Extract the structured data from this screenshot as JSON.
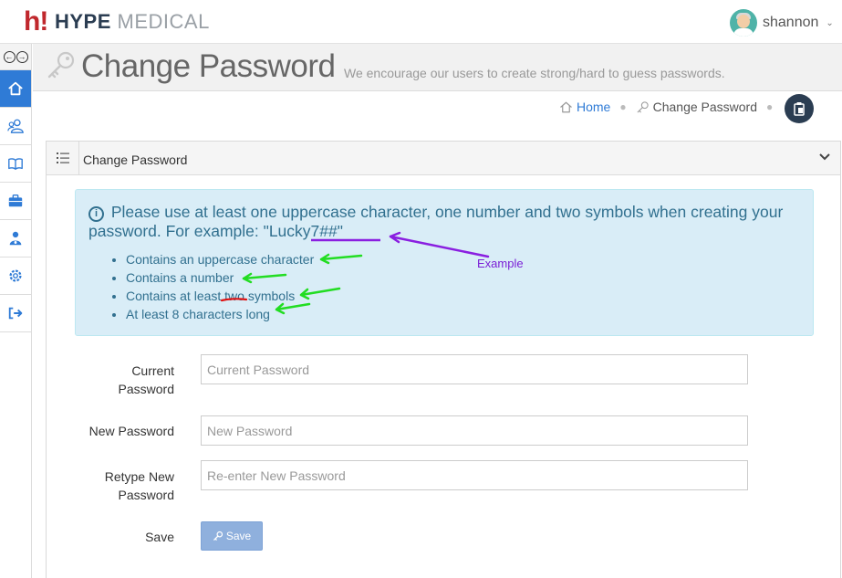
{
  "header": {
    "logo_mark": "h!",
    "logo_brand": "HYPE",
    "logo_brand_2": "MEDICAL",
    "user_name": "shannon"
  },
  "sidebar": {
    "items": [
      {
        "icon": "home-icon",
        "active": true
      },
      {
        "icon": "users-icon",
        "active": false
      },
      {
        "icon": "book-icon",
        "active": false
      },
      {
        "icon": "briefcase-icon",
        "active": false
      },
      {
        "icon": "doctor-icon",
        "active": false
      },
      {
        "icon": "gear-icon",
        "active": false
      },
      {
        "icon": "sign-out-icon",
        "active": false
      }
    ]
  },
  "page": {
    "title": "Change Password",
    "subtitle": "We encourage our users to create strong/hard to guess passwords."
  },
  "breadcrumb": {
    "home": "Home",
    "current": "Change Password"
  },
  "panel": {
    "title": "Change Password"
  },
  "alert": {
    "message_prefix": "Please use at least one uppercase character, one number and two symbols when creating your password. For example: ",
    "example": "\"Lucky7##\"",
    "rules": [
      "Contains an uppercase character",
      "Contains a number",
      "Contains at least two symbols",
      "At least 8 characters long"
    ]
  },
  "form": {
    "current_label_1": "Current",
    "current_label_2": "Password",
    "current_placeholder": "Current Password",
    "new_label": "New Password",
    "new_placeholder": "New Password",
    "retype_label_1": "Retype New",
    "retype_label_2": "Password",
    "retype_placeholder": "Re-enter New Password",
    "save_label": "Save",
    "save_button": "Save"
  },
  "annotations": {
    "example_label": "Example",
    "arrow_color_green": "#22dd22",
    "arrow_color_purple": "#8a1fe0",
    "underline_color_red": "#e01010"
  }
}
